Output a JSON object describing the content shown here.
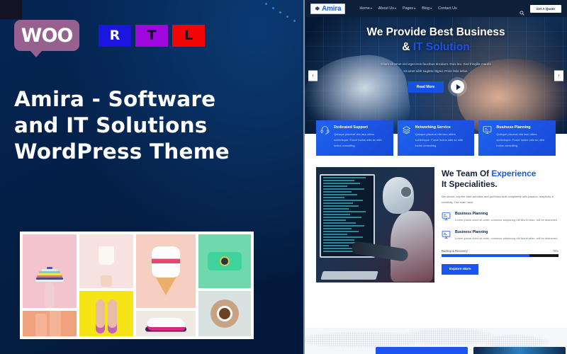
{
  "promo": {
    "badges": {
      "woo_label": "WOO",
      "rtl": [
        "R",
        "T",
        "L"
      ]
    },
    "headline_lines": [
      "Amira - Software",
      "and IT Solutions",
      "WordPress Theme"
    ],
    "colors": {
      "panel_bg": "#04214b",
      "woo_badge": "#96608f",
      "rtl_r": "#1a16e0",
      "rtl_t": "#9e07dd",
      "rtl_l": "#f40505",
      "accent": "#1a55ef"
    },
    "gallery": [
      {
        "name": "layered-cake-on-hand",
        "bg": "#f3c4ce"
      },
      {
        "name": "milk-bottles",
        "bg": "#f0a27e"
      },
      {
        "name": "hand-holding-cup",
        "bg": "#f6e2de"
      },
      {
        "name": "painted-hands",
        "bg": "#f7e416"
      },
      {
        "name": "sprinkle-ice-cream",
        "bg": "#f6cfc1"
      },
      {
        "name": "running-sneaker",
        "bg": "#efe9e4"
      },
      {
        "name": "retro-camera",
        "bg": "#6fd9ab"
      },
      {
        "name": "coffee-cup-top-view",
        "bg": "#d8e3e1"
      }
    ]
  },
  "site": {
    "header": {
      "logo_text": "Amira",
      "nav": [
        {
          "label": "Home",
          "caret": "▾"
        },
        {
          "label": "About Us",
          "caret": "▾"
        },
        {
          "label": "Pages",
          "caret": "▾"
        },
        {
          "label": "Blog",
          "caret": "▾"
        },
        {
          "label": "Contact Us",
          "caret": ""
        }
      ],
      "search_icon": "search-icon",
      "quote_button": "Get A Quote"
    },
    "hero": {
      "title_line1": "We Provide Best Business",
      "title_line2_plain": "& ",
      "title_line2_accent": "IT Solution",
      "paragraph": "Etiam sit amet nisl eget eros faucibus tincidunt. Duis leo. Sed fringilla mauris sit amet nibh sagittis ritigrid. Proin felis tellus.",
      "cta_label": "Read More",
      "play_icon": "play-icon",
      "prev_arrow": "‹",
      "next_arrow": "›"
    },
    "services": [
      {
        "icon": "headset-icon",
        "title": "Dedicated Support",
        "text": "Quisque placerat vita lacu utters scelerisque. Fusce luctus odio ac nibh luctus consulting."
      },
      {
        "icon": "layers-icon",
        "title": "Networking Service",
        "text": "Quisque placerat vita lacu utters scelerisque. Fusce luctus odio ac nibh luctus consulting."
      },
      {
        "icon": "monitor-icon",
        "title": "Business Planning",
        "text": "Quisque placerat vita lacu utters scelerisque. Fusce luctus odio ac nibh luctus consulting."
      }
    ],
    "team": {
      "image_alt": "robot-at-computer",
      "heading_plain1": "We Team Of ",
      "heading_accent": "Experience",
      "heading_plain2": "It Specialities.",
      "paragraph": "We shows only the best websites and portfolios built completely with passion, simplicity & creativity. Our team have.",
      "features": [
        {
          "icon": "monitor-icon",
          "title": "Business Planning",
          "text": "Lorem ipsum dolor sit amet, consecte adipiscing elit Morbi etiao, will be distracted"
        },
        {
          "icon": "monitor-icon",
          "title": "Business Planning",
          "text": "Lorem ipsum dolor sit amet, consecte adipiscing elit Morbi etiao, will be distracted"
        }
      ],
      "progress": {
        "label": "Backup & Recovery",
        "value": "75%",
        "percent": 75
      },
      "cta_label": "Explore More"
    },
    "bottom": {
      "map_alt": "dotted-world-map"
    }
  }
}
